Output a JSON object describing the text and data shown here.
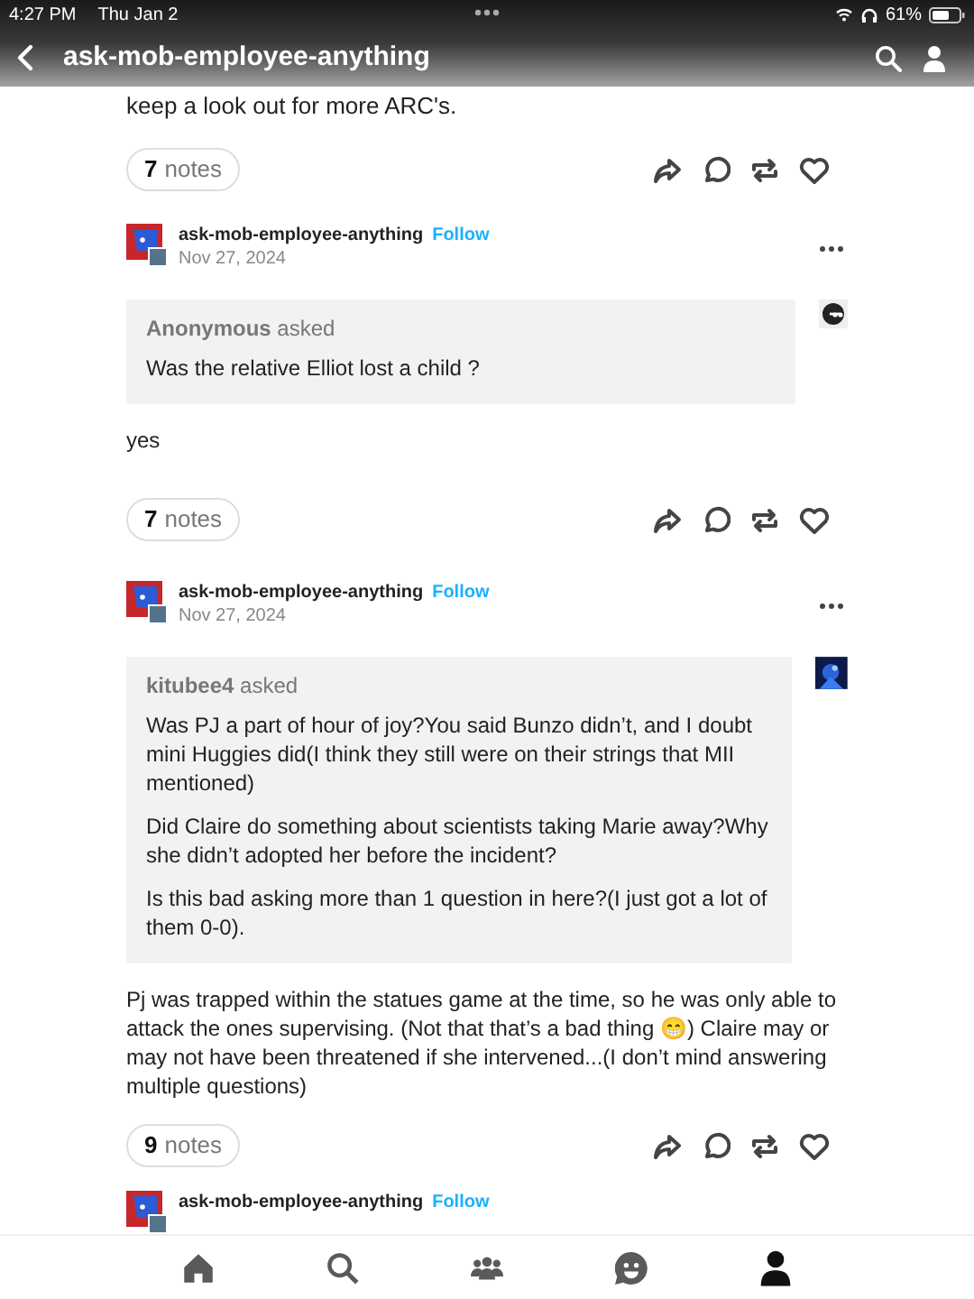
{
  "status_bar": {
    "time": "4:27 PM",
    "date": "Thu Jan 2",
    "battery": "61%"
  },
  "header": {
    "title": "ask-mob-employee-anything"
  },
  "top_fragment": {
    "text": "keep a look out for more ARC's.",
    "notes_count": "7",
    "notes_label": "notes"
  },
  "posts": [
    {
      "blog": "ask-mob-employee-anything",
      "follow": "Follow",
      "date": "Nov 27, 2024",
      "asker": "Anonymous",
      "asked": "asked",
      "question": [
        "Was the relative Elliot lost a child ?"
      ],
      "answer": "yes",
      "notes_count": "7",
      "notes_label": "notes"
    },
    {
      "blog": "ask-mob-employee-anything",
      "follow": "Follow",
      "date": "Nov 27, 2024",
      "asker": "kitubee4",
      "asked": "asked",
      "question": [
        "Was PJ a part of hour of joy?You said Bunzo didn’t, and I doubt mini Huggies did(I think they still were on their strings that MII mentioned)",
        "Did Claire do something about scientists taking Marie away?Why she didn’t adopted her before the incident?",
        "Is this bad asking more than 1 question in here?(I just got a lot of them 0-0)."
      ],
      "answer": "Pj was trapped within the statues game at the time, so he was only able to attack the ones supervising. (Not that that’s a bad thing 😁) Claire may or may not have been threatened if she intervened...(I don’t mind answering multiple questions)",
      "notes_count": "9",
      "notes_label": "notes"
    }
  ],
  "next_post": {
    "blog": "ask-mob-employee-anything",
    "follow": "Follow"
  },
  "tab_bar": {
    "tabs": [
      {
        "selected": false
      },
      {
        "selected": false
      },
      {
        "selected": false
      },
      {
        "selected": false
      },
      {
        "selected": true
      }
    ]
  }
}
